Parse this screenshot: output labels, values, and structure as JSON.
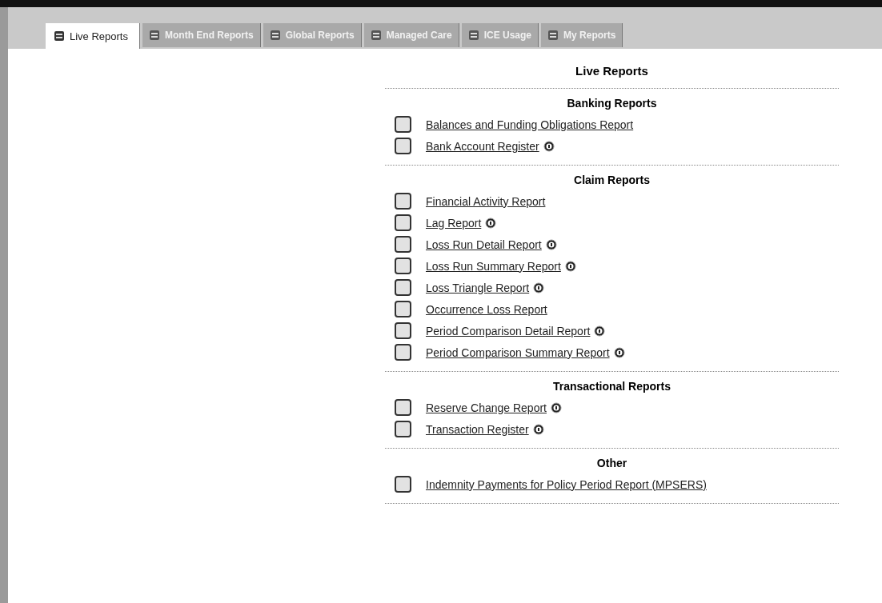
{
  "tabs": [
    {
      "label": "Live Reports",
      "selected": true
    },
    {
      "label": "Month End Reports",
      "selected": false
    },
    {
      "label": "Global Reports",
      "selected": false
    },
    {
      "label": "Managed Care",
      "selected": false
    },
    {
      "label": "ICE Usage",
      "selected": false
    },
    {
      "label": "My Reports",
      "selected": false
    }
  ],
  "title": "Live Reports",
  "sections": [
    {
      "heading": "Banking Reports",
      "reports": [
        {
          "label": "Balances and Funding Obligations Report",
          "help": false
        },
        {
          "label": "Bank Account Register",
          "help": true
        }
      ]
    },
    {
      "heading": "Claim Reports",
      "reports": [
        {
          "label": "Financial Activity Report",
          "help": false
        },
        {
          "label": "Lag Report",
          "help": true
        },
        {
          "label": "Loss Run Detail Report",
          "help": true
        },
        {
          "label": "Loss Run Summary Report",
          "help": true
        },
        {
          "label": "Loss Triangle Report",
          "help": true
        },
        {
          "label": "Occurrence Loss Report",
          "help": false
        },
        {
          "label": "Period Comparison Detail Report",
          "help": true
        },
        {
          "label": "Period Comparison Summary Report",
          "help": true
        }
      ]
    },
    {
      "heading": "Transactional Reports",
      "reports": [
        {
          "label": "Reserve Change Report",
          "help": true
        },
        {
          "label": "Transaction Register",
          "help": true
        }
      ]
    },
    {
      "heading": "Other",
      "reports": [
        {
          "label": "Indemnity Payments for Policy Period Report (MPSERS)",
          "help": false
        }
      ]
    }
  ]
}
